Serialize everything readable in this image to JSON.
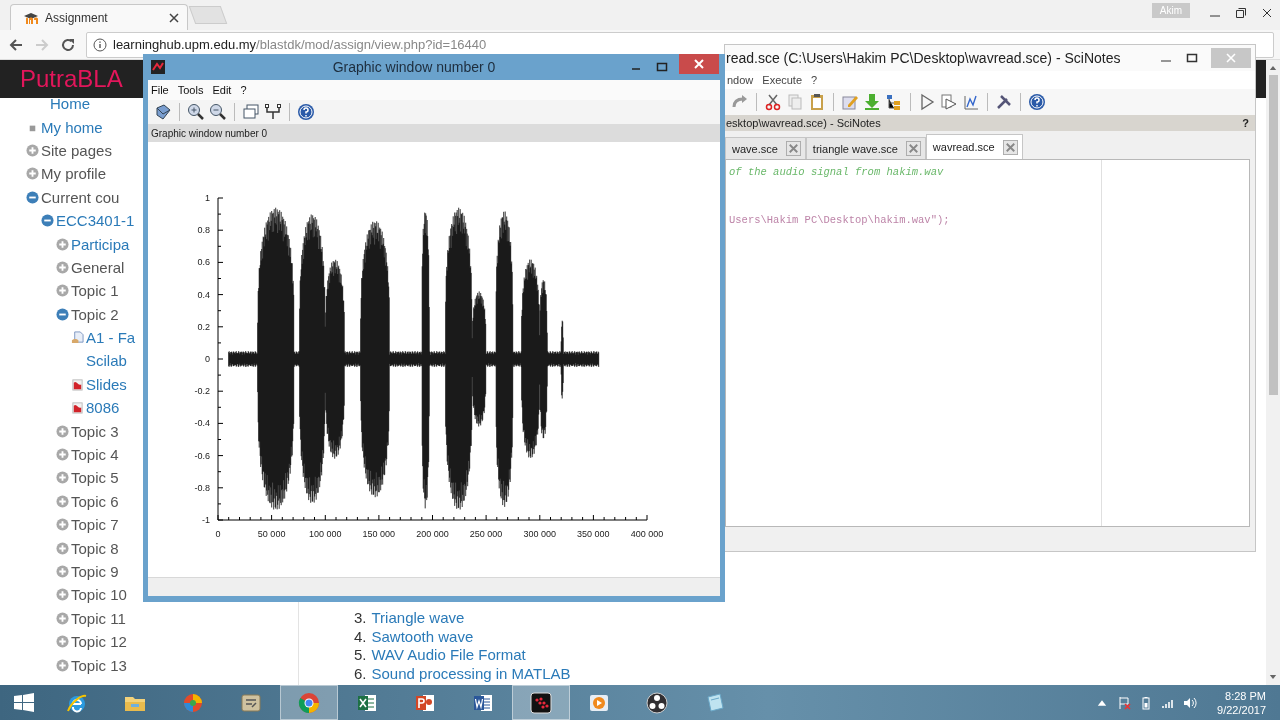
{
  "browser": {
    "tab": {
      "title": "Assignment"
    },
    "address": {
      "host": "learninghub.upm.edu.my",
      "path": "/blastdk/mod/assign/view.php?id=16440"
    },
    "profile": "Akim"
  },
  "site": {
    "brand": "PutraBLA"
  },
  "nav": [
    {
      "label": "Home",
      "kind": "heading",
      "link": true
    },
    {
      "label": "My home",
      "kind": "page",
      "link": true
    },
    {
      "label": "Site pages",
      "kind": "node",
      "expanded": false,
      "link": false
    },
    {
      "label": "My profile",
      "kind": "node",
      "expanded": false,
      "link": false
    },
    {
      "label": "Current cou",
      "kind": "node",
      "expanded": true,
      "link": false,
      "children": [
        {
          "label": "ECC3401-1",
          "kind": "node",
          "expanded": true,
          "link": true,
          "children": [
            {
              "label": "Participa",
              "kind": "node",
              "expanded": false,
              "link": true
            },
            {
              "label": "General",
              "kind": "node",
              "expanded": false,
              "link": false
            },
            {
              "label": "Topic 1",
              "kind": "node",
              "expanded": false,
              "link": false
            },
            {
              "label": "Topic 2",
              "kind": "node",
              "expanded": true,
              "link": false,
              "children": [
                {
                  "label": "A1 - Fa",
                  "continuation": "Scilab",
                  "kind": "assignment",
                  "link": true
                },
                {
                  "label": "Slides",
                  "kind": "pdf",
                  "link": true
                },
                {
                  "label": "8086",
                  "kind": "pdf",
                  "link": true
                }
              ]
            },
            {
              "label": "Topic 3",
              "kind": "node",
              "expanded": false,
              "link": false
            },
            {
              "label": "Topic 4",
              "kind": "node",
              "expanded": false,
              "link": false
            },
            {
              "label": "Topic 5",
              "kind": "node",
              "expanded": false,
              "link": false
            },
            {
              "label": "Topic 6",
              "kind": "node",
              "expanded": false,
              "link": false
            },
            {
              "label": "Topic 7",
              "kind": "node",
              "expanded": false,
              "link": false
            },
            {
              "label": "Topic 8",
              "kind": "node",
              "expanded": false,
              "link": false
            },
            {
              "label": "Topic 9",
              "kind": "node",
              "expanded": false,
              "link": false
            },
            {
              "label": "Topic 10",
              "kind": "node",
              "expanded": false,
              "link": false
            },
            {
              "label": "Topic 11",
              "kind": "node",
              "expanded": false,
              "link": false
            },
            {
              "label": "Topic 12",
              "kind": "node",
              "expanded": false,
              "link": false
            },
            {
              "label": "Topic 13",
              "kind": "node",
              "expanded": false,
              "link": false
            }
          ]
        }
      ]
    }
  ],
  "content_list": [
    {
      "number": "3.",
      "label": "Triangle wave"
    },
    {
      "number": "4.",
      "label": "Sawtooth wave"
    },
    {
      "number": "5.",
      "label": "WAV Audio File Format"
    },
    {
      "number": "6.",
      "label": "Sound processing in MATLAB"
    }
  ],
  "scinotes": {
    "title": "read.sce (C:\\Users\\Hakim PC\\Desktop\\wavread.sce) - SciNotes",
    "menu": [
      "ndow",
      "Execute",
      "?"
    ],
    "doc_title": "esktop\\wavread.sce) - SciNotes",
    "help": "?",
    "tabs": [
      {
        "label": "wave.sce",
        "selected": false
      },
      {
        "label": "triangle wave.sce",
        "selected": false
      },
      {
        "label": "wavread.sce",
        "selected": true
      }
    ],
    "code_lines": [
      {
        "kind": "comment",
        "text": "of the audio signal from hakim.wav"
      },
      {
        "kind": "string",
        "text": "Users\\Hakim PC\\Desktop\\hakim.wav\");"
      }
    ]
  },
  "graphic_window": {
    "title": "Graphic window number 0",
    "menu": [
      "File",
      "Tools",
      "Edit",
      "?"
    ],
    "caption": "Graphic window number 0",
    "y_tick_labels": [
      "1",
      "0.8",
      "0.6",
      "0.4",
      "0.2",
      "0",
      "-0.2",
      "-0.4",
      "-0.6",
      "-0.8",
      "-1"
    ],
    "x_tick_labels": [
      "0",
      "50 000",
      "100 000",
      "150 000",
      "200 000",
      "250 000",
      "300 000",
      "350 000",
      "400 000"
    ]
  },
  "taskbar": {
    "apps": [
      {
        "kind": "ie",
        "active": false
      },
      {
        "kind": "folder",
        "active": false
      },
      {
        "kind": "ball",
        "active": false
      },
      {
        "kind": "toolbox",
        "active": false
      },
      {
        "kind": "chrome",
        "active": true
      },
      {
        "kind": "sheet",
        "active": false
      },
      {
        "kind": "slides",
        "active": false
      },
      {
        "kind": "doc",
        "active": false
      },
      {
        "kind": "scilab",
        "active": true
      },
      {
        "kind": "player",
        "active": false
      },
      {
        "kind": "ring",
        "active": false
      },
      {
        "kind": "notepad",
        "active": false
      }
    ],
    "time": "8:28 PM",
    "date": "9/22/2017"
  }
}
